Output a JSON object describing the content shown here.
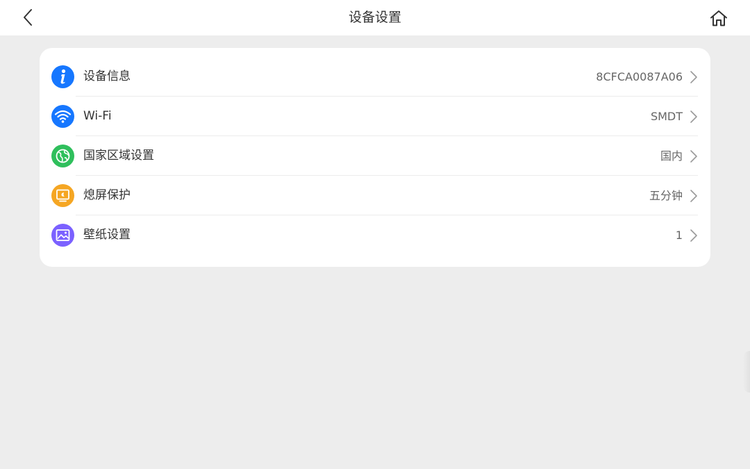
{
  "header": {
    "title": "设备设置",
    "back_icon": "chevron-left-icon",
    "home_icon": "home-icon"
  },
  "settings": {
    "items": [
      {
        "id": "device-info",
        "label": "设备信息",
        "value": "8CFCA0087A06",
        "icon": "info-icon",
        "color": "#1677ff"
      },
      {
        "id": "wifi",
        "label": "Wi-Fi",
        "value": "SMDT",
        "icon": "wifi-icon",
        "color": "#1677ff"
      },
      {
        "id": "region",
        "label": "国家区域设置",
        "value": "国内",
        "icon": "globe-icon",
        "color": "#2fbf5c"
      },
      {
        "id": "screensaver",
        "label": "熄屏保护",
        "value": "五分钟",
        "icon": "screensaver-icon",
        "color": "#f5a623"
      },
      {
        "id": "wallpaper",
        "label": "壁纸设置",
        "value": "1",
        "icon": "image-icon",
        "color": "#7b61ff"
      }
    ]
  },
  "colors": {
    "background": "#ededed",
    "card": "#ffffff",
    "text_primary": "#333333",
    "text_secondary": "#666666",
    "chevron": "#9a9a9a"
  }
}
